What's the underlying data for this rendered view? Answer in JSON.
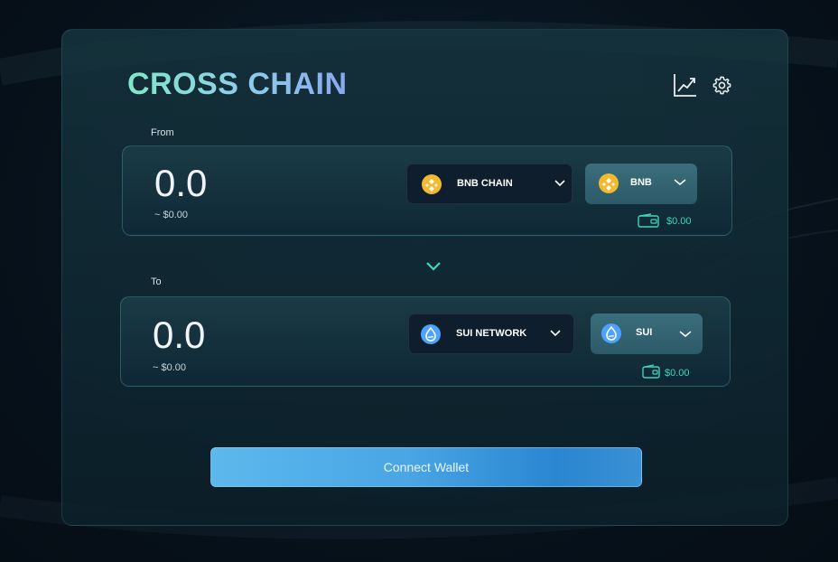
{
  "app": {
    "title": "CROSS CHAIN"
  },
  "from": {
    "label": "From",
    "amount": "0.0",
    "usd": "~ $0.00",
    "network": "BNB CHAIN",
    "token": "BNB",
    "balance": "$0.00"
  },
  "to": {
    "label": "To",
    "amount": "0.0",
    "usd": "~ $0.00",
    "network": "SUI NETWORK",
    "token": "SUI",
    "balance": "$0.00"
  },
  "actions": {
    "connect_label": "Connect Wallet"
  },
  "icons": {
    "chart": "chart-trend-icon",
    "settings": "gear-icon",
    "swap": "chevron-down-icon",
    "bnb": "bnb-coin-icon",
    "sui": "sui-coin-icon",
    "wallet": "wallet-icon"
  },
  "colors": {
    "accent": "#3fd6b8",
    "bnb": "#f3ba2f",
    "sui": "#4ca2ff",
    "button": "#4aa6e4"
  }
}
